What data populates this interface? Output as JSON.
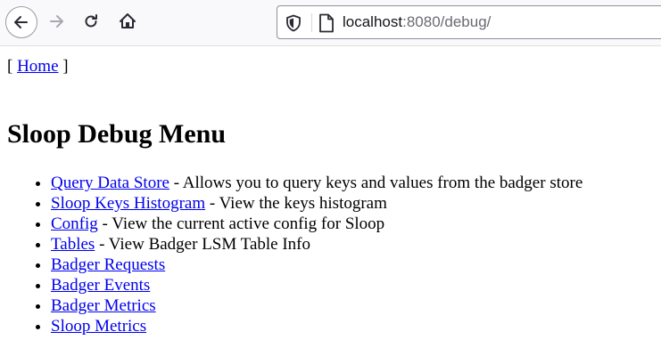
{
  "browser": {
    "url_host": "localhost",
    "url_rest": ":8080/debug/",
    "icons": {
      "back": "back-arrow-icon",
      "forward": "forward-arrow-icon",
      "reload": "reload-icon",
      "home": "home-icon",
      "shield": "shield-icon",
      "page": "page-icon"
    }
  },
  "page": {
    "breadcrumb_open": "[",
    "breadcrumb_link": "Home",
    "breadcrumb_close": "]",
    "title": "Sloop Debug Menu",
    "menu": [
      {
        "link": "Query Data Store",
        "desc": " - Allows you to query keys and values from the badger store"
      },
      {
        "link": "Sloop Keys Histogram",
        "desc": " - View the keys histogram"
      },
      {
        "link": "Config",
        "desc": " - View the current active config for Sloop"
      },
      {
        "link": "Tables",
        "desc": " - View Badger LSM Table Info"
      },
      {
        "link": "Badger Requests",
        "desc": ""
      },
      {
        "link": "Badger Events",
        "desc": ""
      },
      {
        "link": "Badger Metrics",
        "desc": ""
      },
      {
        "link": "Sloop Metrics",
        "desc": ""
      }
    ]
  },
  "colors": {
    "link": "#0000ee",
    "toolbar_bg": "#f9f9fb"
  }
}
